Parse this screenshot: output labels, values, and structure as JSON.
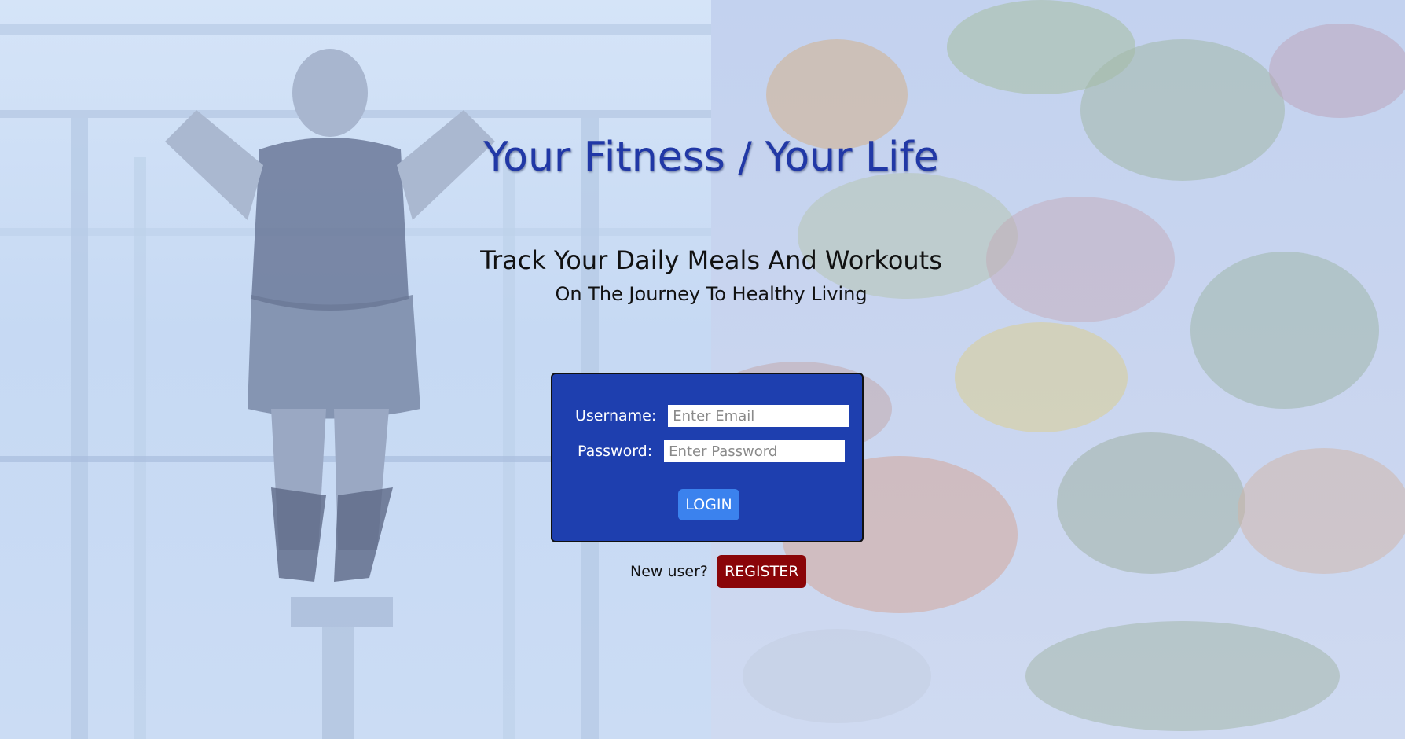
{
  "header": {
    "title": "Your Fitness / Your Life",
    "subtitle": "Track Your Daily Meals And Workouts",
    "tagline": "On The Journey To Healthy Living"
  },
  "login_form": {
    "username_label": "Username:",
    "username_placeholder": "Enter Email",
    "password_label": "Password:",
    "password_placeholder": "Enter Password",
    "login_label": "LOGIN"
  },
  "register": {
    "prompt": "New user?",
    "button_label": "REGISTER"
  },
  "colors": {
    "title": "#2138a6",
    "login_box": "#1e3faf",
    "login_button": "#3b82ee",
    "register_button": "#8a0508"
  },
  "background": {
    "left_image": "gym-pullup-photo",
    "right_image": "vegetables-photo"
  }
}
